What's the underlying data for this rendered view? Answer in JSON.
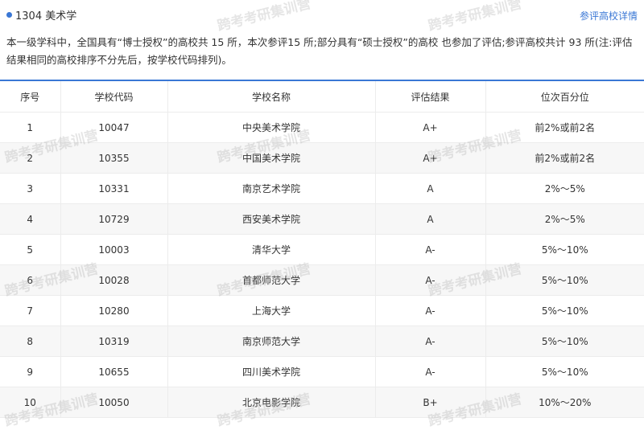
{
  "header": {
    "subject": "1304 美术学",
    "detail_link": "参评高校详情"
  },
  "description": "本一级学科中，全国具有“博士授权”的高校共 15 所，本次参评15 所;部分具有“硕士授权”的高校 也参加了评估;参评高校共计 93 所(注:评估结果相同的高校排序不分先后，按学校代码排列)。",
  "table": {
    "columns": [
      "序号",
      "学校代码",
      "学校名称",
      "评估结果",
      "位次百分位"
    ],
    "rows": [
      [
        "1",
        "10047",
        "中央美术学院",
        "A+",
        "前2%或前2名"
      ],
      [
        "2",
        "10355",
        "中国美术学院",
        "A+",
        "前2%或前2名"
      ],
      [
        "3",
        "10331",
        "南京艺术学院",
        "A",
        "2%～5%"
      ],
      [
        "4",
        "10729",
        "西安美术学院",
        "A",
        "2%～5%"
      ],
      [
        "5",
        "10003",
        "清华大学",
        "A-",
        "5%～10%"
      ],
      [
        "6",
        "10028",
        "首都师范大学",
        "A-",
        "5%～10%"
      ],
      [
        "7",
        "10280",
        "上海大学",
        "A-",
        "5%～10%"
      ],
      [
        "8",
        "10319",
        "南京师范大学",
        "A-",
        "5%～10%"
      ],
      [
        "9",
        "10655",
        "四川美术学院",
        "A-",
        "5%～10%"
      ],
      [
        "10",
        "10050",
        "北京电影学院",
        "B+",
        "10%～20%"
      ]
    ]
  },
  "watermark": "跨考考研集训营",
  "colors": {
    "accent": "#3a77d5",
    "stripe": "#f7f7f7",
    "border": "#ececec"
  }
}
